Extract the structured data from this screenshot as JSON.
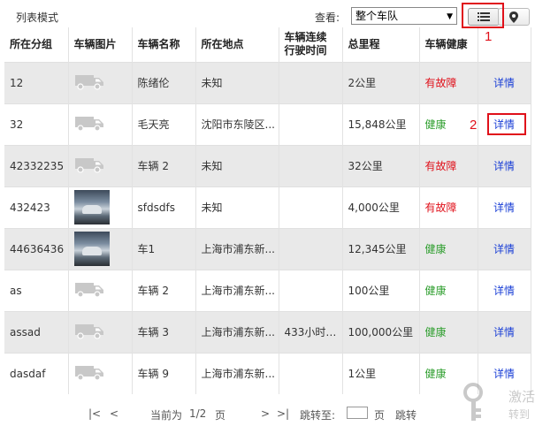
{
  "toolbar": {
    "mode_label": "列表模式",
    "view_label": "查看:",
    "fleet_selected": "整个车队",
    "annotation_1": "1",
    "annotation_2": "2"
  },
  "table": {
    "headers": [
      "所在分组",
      "车辆图片",
      "车辆名称",
      "所在地点",
      "车辆连续\n行驶时间",
      "总里程",
      "车辆健康",
      ""
    ],
    "rows": [
      {
        "group": "12",
        "photo": "van-icon",
        "name": "陈绪伦",
        "location": "未知",
        "drive_time": "",
        "mileage": "2公里",
        "health": "有故障",
        "detail": "详情"
      },
      {
        "group": "32",
        "photo": "van-icon",
        "name": "毛天亮",
        "location": "沈阳市东陵区...",
        "drive_time": "",
        "mileage": "15,848公里",
        "health": "健康",
        "detail": "详情"
      },
      {
        "group": "42332235",
        "photo": "van-icon",
        "name": "车辆 2",
        "location": "未知",
        "drive_time": "",
        "mileage": "32公里",
        "health": "有故障",
        "detail": "详情"
      },
      {
        "group": "432423",
        "photo": "car-photo",
        "name": "sfdsdfs",
        "location": "未知",
        "drive_time": "",
        "mileage": "4,000公里",
        "health": "有故障",
        "detail": "详情"
      },
      {
        "group": "44636436",
        "photo": "car-photo",
        "name": "车1",
        "location": "上海市浦东新...",
        "drive_time": "",
        "mileage": "12,345公里",
        "health": "健康",
        "detail": "详情"
      },
      {
        "group": "as",
        "photo": "van-icon",
        "name": "车辆 2",
        "location": "上海市浦东新...",
        "drive_time": "",
        "mileage": "100公里",
        "health": "健康",
        "detail": "详情"
      },
      {
        "group": "assad",
        "photo": "van-icon",
        "name": "车辆 3",
        "location": "上海市浦东新...",
        "drive_time": "433小时4...",
        "mileage": "100,000公里",
        "health": "健康",
        "detail": "详情"
      },
      {
        "group": "dasdaf",
        "photo": "van-icon",
        "name": "车辆 9",
        "location": "上海市浦东新...",
        "drive_time": "",
        "mileage": "1公里",
        "health": "健康",
        "detail": "详情"
      }
    ]
  },
  "pager": {
    "first": "|<",
    "prev": "<",
    "current_label": "当前为",
    "page": "1/2",
    "page_unit": "页",
    "next": ">",
    "last": ">|",
    "jump_label": "跳转至:",
    "jump_unit": "页",
    "jump_button": "跳转"
  },
  "watermark": {
    "line1": "激活",
    "line2": "转到"
  },
  "colors": {
    "fault": "#e0101a",
    "healthy": "#2e9e2e",
    "detail": "#1a3fd6",
    "stripe": "#e9e9e9",
    "annotation": "#e0101a"
  }
}
